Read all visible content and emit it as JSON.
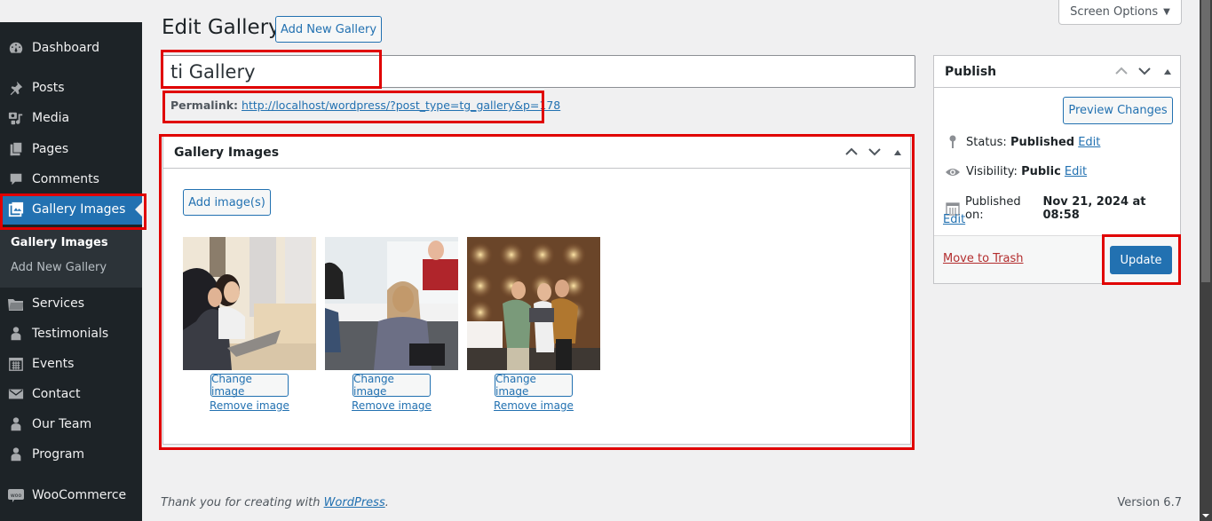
{
  "sidebar": {
    "items": [
      {
        "label": "Dashboard",
        "icon": "dashboard-icon"
      },
      {
        "label": "Posts",
        "icon": "pin-icon"
      },
      {
        "label": "Media",
        "icon": "media-icon"
      },
      {
        "label": "Pages",
        "icon": "pages-icon"
      },
      {
        "label": "Comments",
        "icon": "comment-icon"
      },
      {
        "label": "Gallery Images",
        "icon": "gallery-icon",
        "active": true
      },
      {
        "label": "Services",
        "icon": "folder-icon"
      },
      {
        "label": "Testimonials",
        "icon": "person-icon"
      },
      {
        "label": "Events",
        "icon": "calendar-icon"
      },
      {
        "label": "Contact",
        "icon": "envelope-icon"
      },
      {
        "label": "Our Team",
        "icon": "person-icon"
      },
      {
        "label": "Program",
        "icon": "person-icon"
      },
      {
        "label": "WooCommerce",
        "icon": "woo-icon"
      }
    ],
    "submenu": {
      "current": "Gallery Images",
      "add_new": "Add New Gallery"
    }
  },
  "header": {
    "title": "Edit Gallery",
    "add_new_label": "Add New Gallery",
    "screen_options_label": "Screen Options"
  },
  "post": {
    "title_value": "ti Gallery",
    "permalink_label": "Permalink:",
    "permalink_url": "http://localhost/wordpress/?post_type=tg_gallery&p=178"
  },
  "gallery_box": {
    "title": "Gallery Images",
    "add_images_label": "Add image(s)",
    "images": [
      {
        "alt": "Two women looking at a laptop",
        "change_label": "Change image",
        "remove_label": "Remove image"
      },
      {
        "alt": "Woman talking in office meeting",
        "change_label": "Change image",
        "remove_label": "Remove image"
      },
      {
        "alt": "Three people looking at laptop in front of lit wall",
        "change_label": "Change image",
        "remove_label": "Remove image"
      }
    ]
  },
  "publish_box": {
    "title": "Publish",
    "preview_label": "Preview Changes",
    "status_label": "Status:",
    "status_value": "Published",
    "visibility_label": "Visibility:",
    "visibility_value": "Public",
    "published_on_label": "Published on:",
    "published_on_value": "Nov 21, 2024 at 08:58",
    "edit_label": "Edit",
    "trash_label": "Move to Trash",
    "update_label": "Update"
  },
  "footer": {
    "thanks_prefix": "Thank you for creating with ",
    "thanks_link": "WordPress",
    "thanks_suffix": ".",
    "version": "Version 6.7"
  },
  "colors": {
    "accent": "#2271b1",
    "sidebar_bg": "#1d2327",
    "highlight_box": "#e00000",
    "trash": "#b32d2e"
  }
}
